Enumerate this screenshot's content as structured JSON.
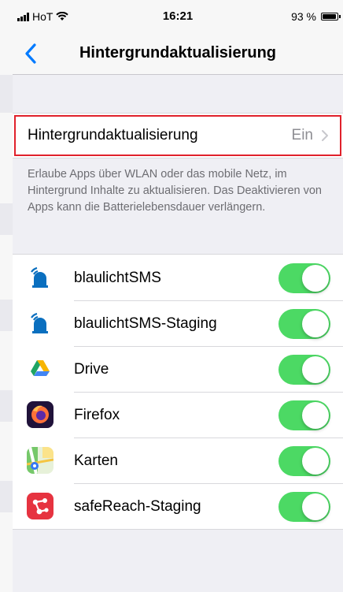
{
  "status_bar": {
    "carrier": "HoT",
    "time": "16:21",
    "battery": "93 %",
    "battery_level": 0.93
  },
  "nav": {
    "title": "Hintergrundaktualisierung"
  },
  "main_setting": {
    "label": "Hintergrundaktualisierung",
    "value": "Ein"
  },
  "description": "Erlaube Apps über WLAN oder das mobile Netz, im Hintergrund Inhalte zu aktualisieren. Das Deaktivieren von Apps kann die Batterielebensdauer verlängern.",
  "apps": [
    {
      "name": "blaulichtSMS",
      "icon": "blaulichtsms-icon",
      "enabled": true
    },
    {
      "name": "blaulichtSMS-Staging",
      "icon": "blaulichtsms-staging-icon",
      "enabled": true
    },
    {
      "name": "Drive",
      "icon": "google-drive-icon",
      "enabled": true
    },
    {
      "name": "Firefox",
      "icon": "firefox-icon",
      "enabled": true
    },
    {
      "name": "Karten",
      "icon": "maps-icon",
      "enabled": true
    },
    {
      "name": "safeReach-Staging",
      "icon": "safereach-icon",
      "enabled": true
    }
  ],
  "colors": {
    "accent": "#007aff",
    "toggle_on": "#4cd964",
    "highlight": "#e0212b"
  }
}
